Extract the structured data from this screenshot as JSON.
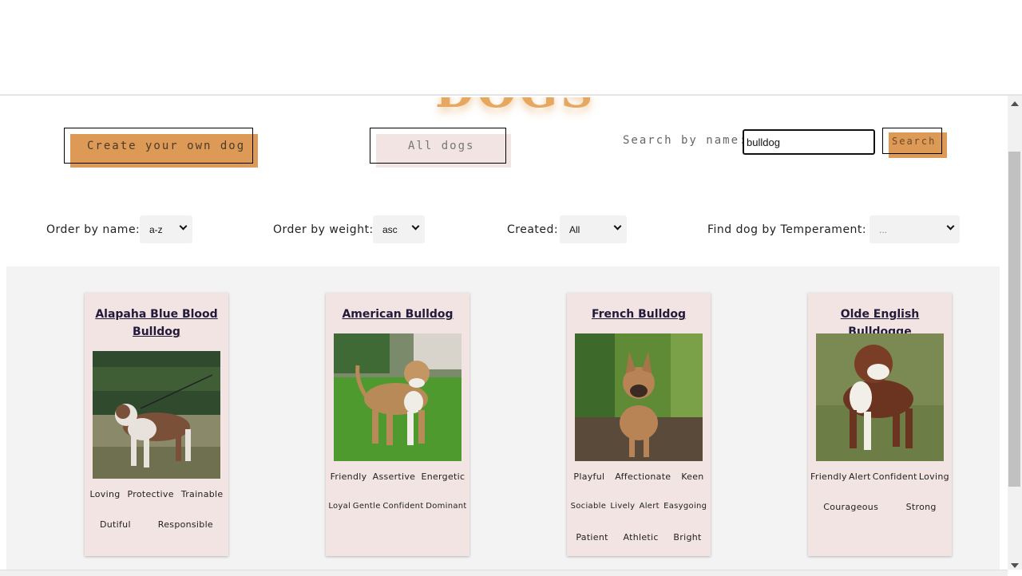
{
  "header": {
    "title": "DOGS"
  },
  "buttons": {
    "create_label": "Create your own dog",
    "all_label": "All dogs",
    "search_label": "Search"
  },
  "search": {
    "label": "Search by name:",
    "value": "bulldog"
  },
  "filters": {
    "order_name": {
      "label": "Order by name:",
      "selected": "a-z"
    },
    "order_weight": {
      "label": "Order by weight:",
      "selected": "asc"
    },
    "created": {
      "label": "Created:",
      "selected": "All"
    },
    "temperament": {
      "label": "Find dog by Temperament:",
      "selected": "..."
    }
  },
  "cards": [
    {
      "name": "Alapaha Blue Blood Bulldog",
      "temperaments": [
        [
          "Loving",
          "Protective",
          "Trainable"
        ],
        [
          "Dutiful",
          "Responsible"
        ]
      ]
    },
    {
      "name": "American Bulldog",
      "temperaments": [
        [
          "Friendly",
          "Assertive",
          "Energetic"
        ],
        [
          "Loyal",
          "Gentle",
          "Confident",
          "Dominant"
        ]
      ]
    },
    {
      "name": "French Bulldog",
      "temperaments": [
        [
          "Playful",
          "Affectionate",
          "Keen"
        ],
        [
          "Sociable",
          "Lively",
          "Alert",
          "Easygoing"
        ],
        [
          "Patient",
          "Athletic",
          "Bright"
        ]
      ]
    },
    {
      "name": "Olde English Bulldogge",
      "temperaments": [
        [
          "Friendly",
          "Alert",
          "Confident",
          "Loving"
        ],
        [
          "Courageous",
          "Strong"
        ]
      ]
    }
  ],
  "colors": {
    "accent": "#dd9a57",
    "pale": "#f1e4e2",
    "grid_bg": "#f3f3f3"
  },
  "icons": {
    "dropdown": "chevron-down-icon",
    "scroll_up": "scroll-up-arrow-icon",
    "scroll_down": "scroll-down-arrow-icon"
  }
}
